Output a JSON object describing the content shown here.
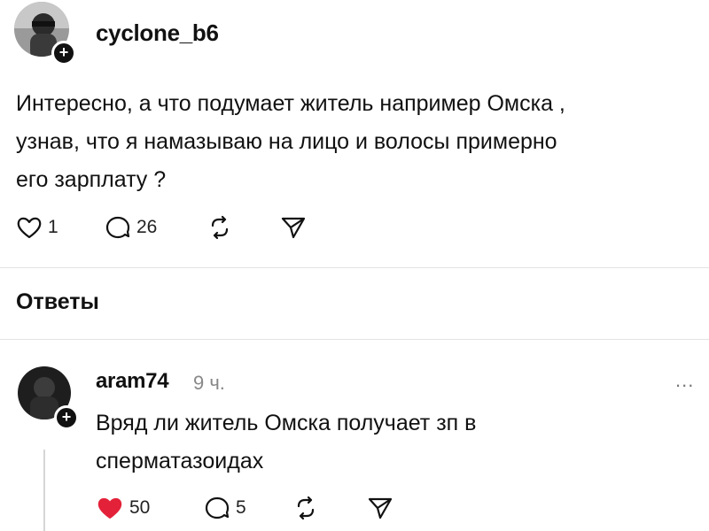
{
  "post": {
    "username": "cyclone_b6",
    "text_lines": [
      "Интересно, а что подумает житель например Омска ,",
      "узнав,  что я намазываю на лицо и волосы примерно",
      "его зарплату ?"
    ],
    "actions": {
      "likes": "1",
      "comments": "26"
    },
    "icons": [
      "plus-icon",
      "heart-icon",
      "comment-icon",
      "repost-icon",
      "share-icon"
    ]
  },
  "replies_section": {
    "title": "Ответы"
  },
  "reply": {
    "username": "aram74",
    "time": "9 ч.",
    "more": "...",
    "text_lines": [
      "Вряд ли житель Омска получает зп в",
      "сперматазоидах"
    ],
    "actions": {
      "likes": "50",
      "comments": "5"
    },
    "liked": true,
    "colors": {
      "liked_heart": "#e3223a"
    }
  }
}
